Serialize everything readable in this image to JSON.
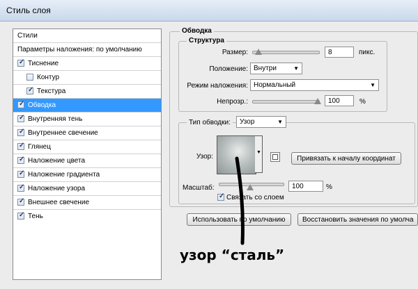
{
  "window": {
    "title": "Стиль слоя"
  },
  "left_list": {
    "header": "Стили",
    "items": [
      {
        "label": "Параметры наложения: по умолчанию",
        "checkbox": false
      },
      {
        "label": "Тиснение",
        "checkbox": true,
        "checked": true
      },
      {
        "label": "Контур",
        "checkbox": true,
        "checked": false,
        "indent": true
      },
      {
        "label": "Текстура",
        "checkbox": true,
        "checked": true,
        "indent": true
      },
      {
        "label": "Обводка",
        "checkbox": true,
        "checked": true,
        "selected": true
      },
      {
        "label": "Внутренняя тень",
        "checkbox": true,
        "checked": true
      },
      {
        "label": "Внутреннее свечение",
        "checkbox": true,
        "checked": true
      },
      {
        "label": "Глянец",
        "checkbox": true,
        "checked": true
      },
      {
        "label": "Наложение цвета",
        "checkbox": true,
        "checked": true
      },
      {
        "label": "Наложение градиента",
        "checkbox": true,
        "checked": true
      },
      {
        "label": "Наложение узора",
        "checkbox": true,
        "checked": true
      },
      {
        "label": "Внешнее свечение",
        "checkbox": true,
        "checked": true
      },
      {
        "label": "Тень",
        "checkbox": true,
        "checked": true
      }
    ]
  },
  "stroke": {
    "section_title": "Обводка",
    "structure_title": "Структура",
    "size": {
      "label": "Размер:",
      "value": "8",
      "unit": "пикс."
    },
    "position": {
      "label": "Положение:",
      "value": "Внутри"
    },
    "blend_mode": {
      "label": "Режим наложения:",
      "value": "Нормальный"
    },
    "opacity": {
      "label": "Непрозр.:",
      "value": "100",
      "unit": "%"
    },
    "fill_type": {
      "label": "Тип обводки:",
      "value": "Узор"
    },
    "pattern": {
      "label": "Узор:"
    },
    "snap_button": "Привязать к началу координат",
    "scale": {
      "label": "Масштаб:",
      "value": "100",
      "unit": "%"
    },
    "link_with_layer": {
      "label": "Связать со слоем",
      "checked": true
    }
  },
  "buttons": {
    "default": "Использовать по умолчанию",
    "restore": "Восстановить значения по умолча"
  },
  "annotation": "узор “сталь”"
}
